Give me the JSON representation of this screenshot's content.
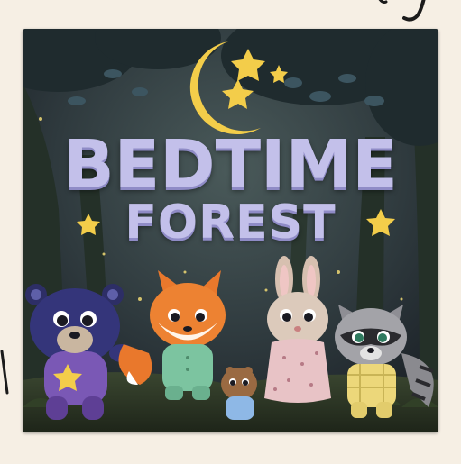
{
  "cover": {
    "title_line1": "BEDTIME",
    "title_line2": "FOREST"
  },
  "colors": {
    "background": "#f6efe4",
    "sky": "#2c3342",
    "moon": "#f3cd4a",
    "title": "#c3c0ea",
    "ground": "#2a3324"
  },
  "characters": [
    "bear",
    "fox",
    "squirrel",
    "bunny",
    "raccoon"
  ]
}
